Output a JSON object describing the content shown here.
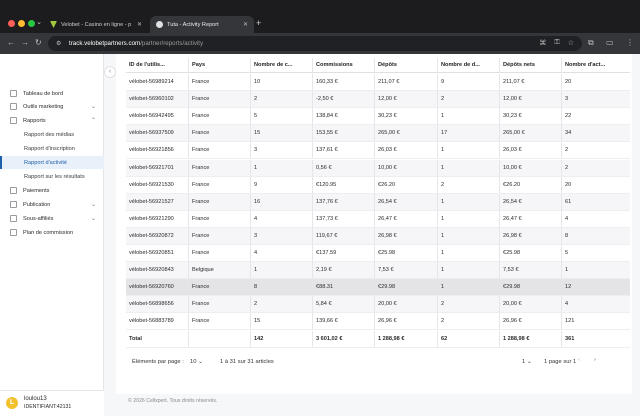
{
  "browser": {
    "tabs": [
      {
        "title": "Velobet - Casino en ligne - p"
      },
      {
        "title": "Tuta - Activity Report"
      }
    ],
    "url_host": "track.velobetpartners.com",
    "url_path": "/partner/reports/activity"
  },
  "sidebar": {
    "items": [
      {
        "label": "Tableau de bord"
      },
      {
        "label": "Outils marketing"
      },
      {
        "label": "Rapports"
      },
      {
        "label": "Rapport des médias"
      },
      {
        "label": "Rapport d'inscription"
      },
      {
        "label": "Rapport d'activité"
      },
      {
        "label": "Rapport sur les résultats"
      },
      {
        "label": "Paiements"
      },
      {
        "label": "Publication"
      },
      {
        "label": "Sous-affiliés"
      },
      {
        "label": "Plan de commission"
      }
    ],
    "user": {
      "avatar_letter": "L",
      "name": "loulou13",
      "id": "IDENTIFIANT:42131"
    }
  },
  "table": {
    "headers": [
      "ID de l'utilis...",
      "Pays",
      "Nombre de c...",
      "Commissions",
      "Dépôts",
      "Nombre de d...",
      "Dépôts nets",
      "Nombre d'act..."
    ],
    "rows": [
      [
        "vélobet-56989214",
        "France",
        "10",
        "160,33 €",
        "211,07 €",
        "9",
        "211,07 €",
        "20"
      ],
      [
        "vélobet-56960102",
        "France",
        "2",
        "-2,50 €",
        "12,00 €",
        "2",
        "12,00 €",
        "3"
      ],
      [
        "vélobet-56942495",
        "France",
        "5",
        "138,84 €",
        "30,23 €",
        "1",
        "30,23 €",
        "22"
      ],
      [
        "vélobet-56937509",
        "France",
        "15",
        "153,55 €",
        "265,00 €",
        "17",
        "265,00 €",
        "34"
      ],
      [
        "vélobet-56921856",
        "France",
        "3",
        "137,61 €",
        "26,03 €",
        "1",
        "26,03 €",
        "2"
      ],
      [
        "vélobet-56921701",
        "France",
        "1",
        "0,56 €",
        "10,00 €",
        "1",
        "10,00 €",
        "2"
      ],
      [
        "vélobet-56921530",
        "France",
        "9",
        "€120.95",
        "€26.20",
        "2",
        "€26.20",
        "20"
      ],
      [
        "vélobet-56921527",
        "France",
        "16",
        "137,76 €",
        "26,54 €",
        "1",
        "26,54 €",
        "61"
      ],
      [
        "vélobet-56921290",
        "France",
        "4",
        "137,73 €",
        "26,47 €",
        "1",
        "26,47 €",
        "4"
      ],
      [
        "vélobet-56920872",
        "France",
        "3",
        "119,67 €",
        "26,98 €",
        "1",
        "26,98 €",
        "8"
      ],
      [
        "vélobet-56920851",
        "France",
        "4",
        "€137.59",
        "€25.98",
        "1",
        "€25.98",
        "5"
      ],
      [
        "vélobet-56920843",
        "Belgique",
        "1",
        "2,19 €",
        "7,53 €",
        "1",
        "7,53 €",
        "1"
      ],
      [
        "vélobet-56920760",
        "France",
        "8",
        "€88.31",
        "€29.98",
        "1",
        "€29.98",
        "12"
      ],
      [
        "vélobet-56898656",
        "France",
        "2",
        "5,84 €",
        "20,00 €",
        "2",
        "20,00 €",
        "4"
      ],
      [
        "vélobet-56883789",
        "France",
        "15",
        "139,66 €",
        "26,96 €",
        "2",
        "26,96 €",
        "121"
      ]
    ],
    "total": [
      "Total",
      "",
      "142",
      "3 601,02 €",
      "1 288,98 €",
      "62",
      "1 288,98 €",
      "361"
    ]
  },
  "pagination": {
    "per_page_label": "Éléments par page :",
    "per_page_value": "10",
    "range_text": "1 à 31 sur 31 articles",
    "current_page": "1",
    "page_of": "1 page sur 1"
  },
  "footer": {
    "text": "© 2026 Cellxpert. Tous droits réservés."
  }
}
